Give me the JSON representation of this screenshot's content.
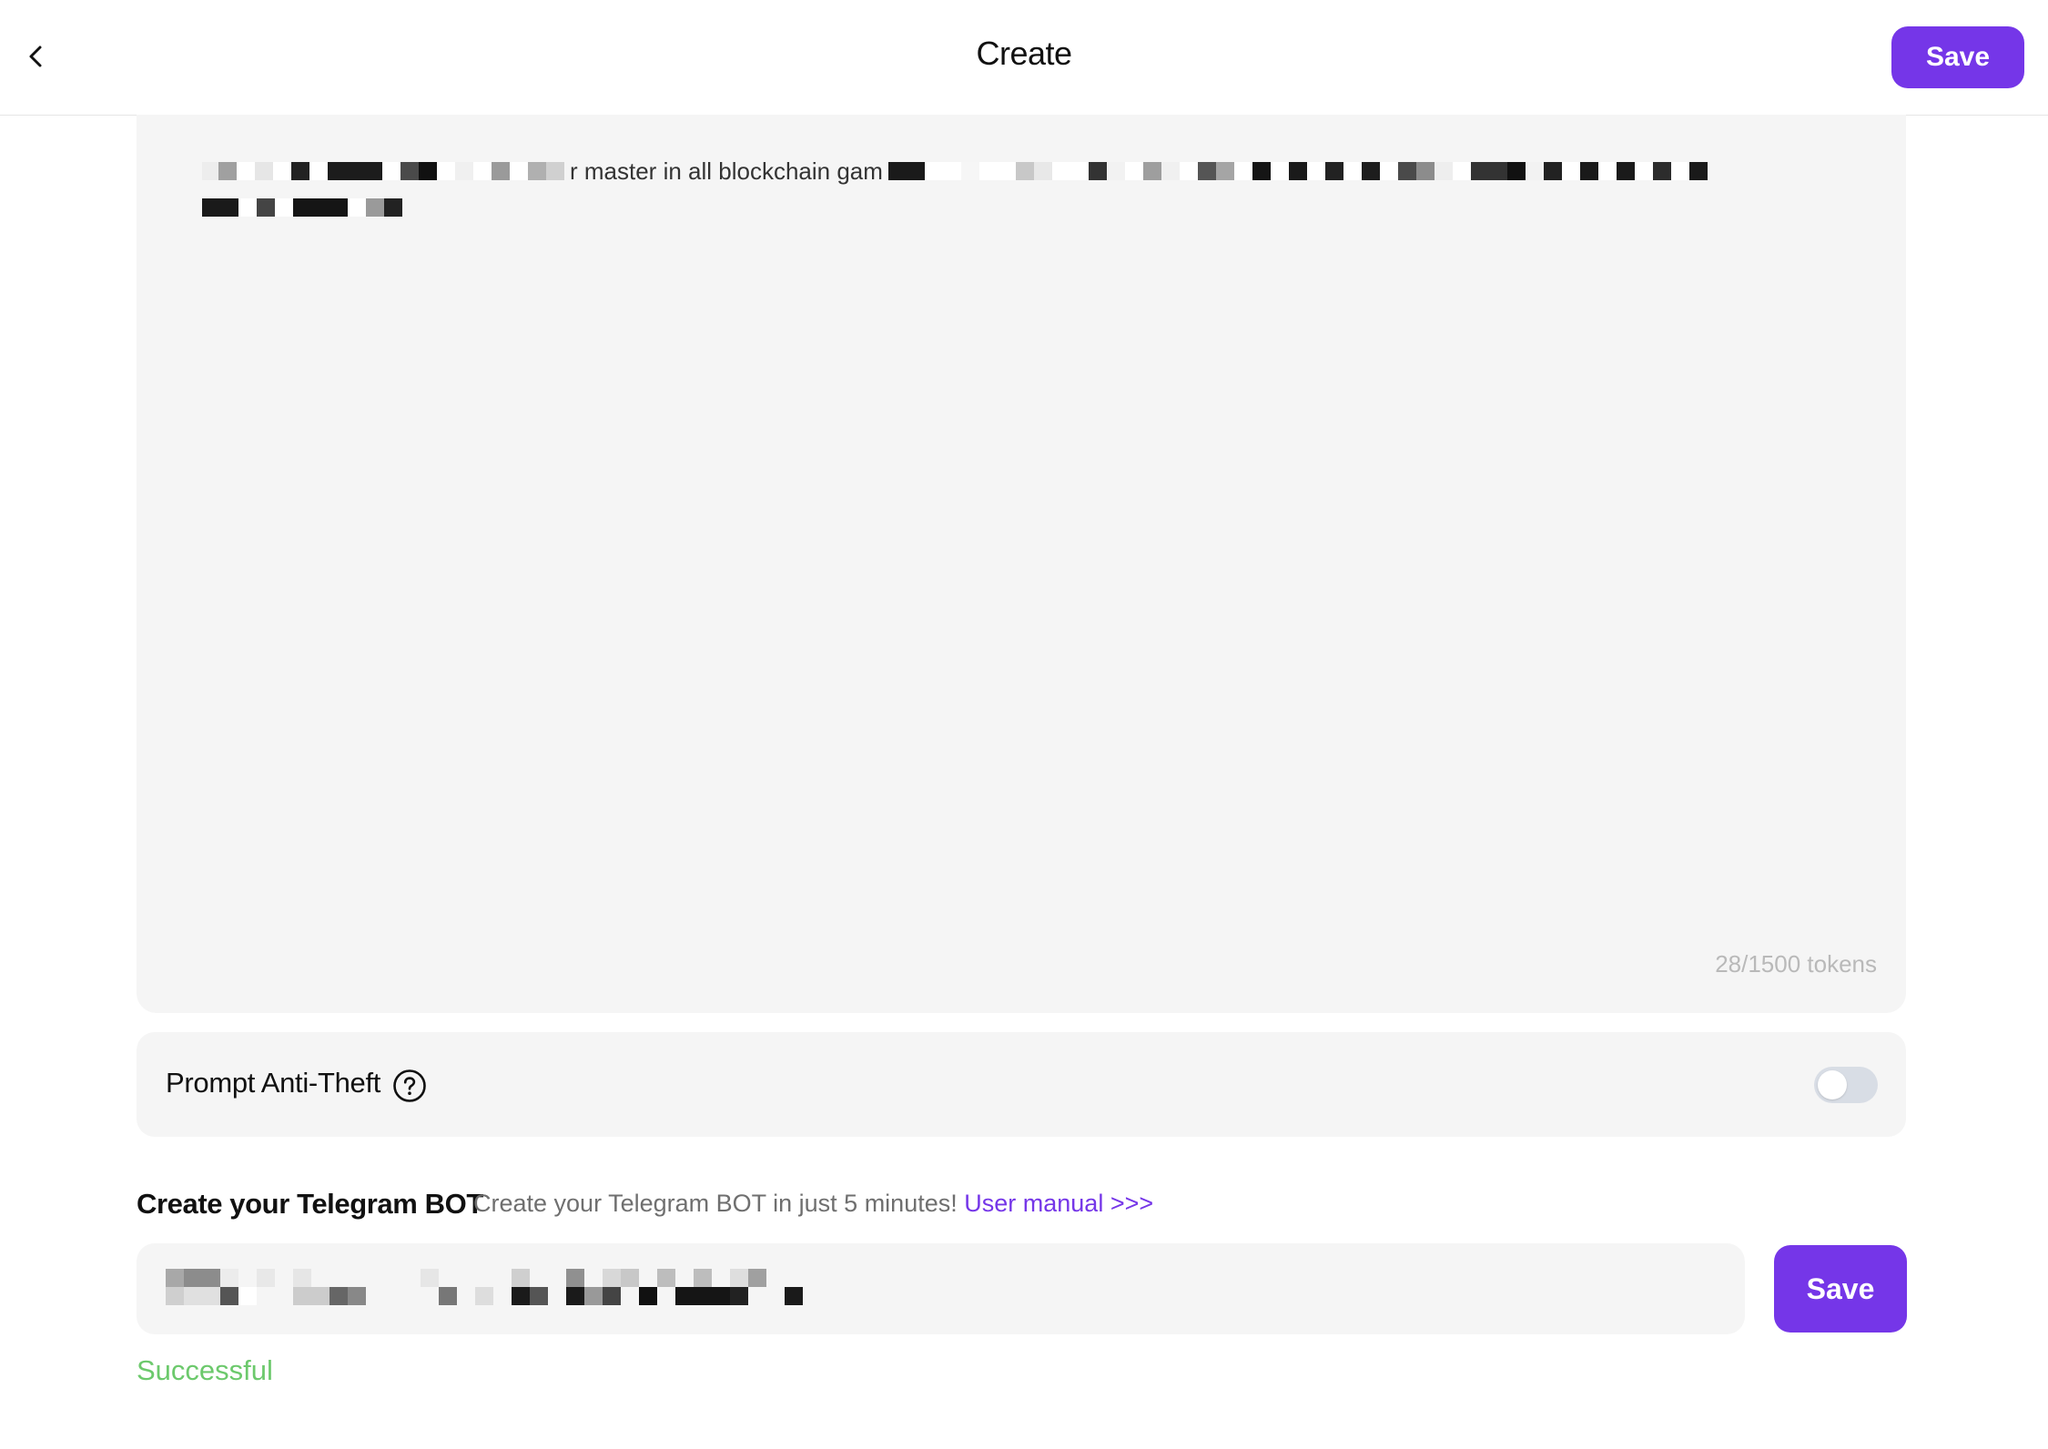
{
  "header": {
    "title": "Create",
    "save_label": "Save",
    "back_icon": "chevron-left-icon"
  },
  "prompt": {
    "visible_fragment": "r master in all blockchain gam",
    "token_count": "28/1500 tokens"
  },
  "anti_theft": {
    "label": "Prompt Anti-Theft",
    "help_icon": "question-circle-icon",
    "enabled": false
  },
  "telegram": {
    "title": "Create your Telegram BOT",
    "subtitle": "Create your Telegram BOT in just 5 minutes!",
    "manual_link": "User manual >>>",
    "save_label": "Save",
    "status": "Successful"
  },
  "colors": {
    "accent": "#7536e8",
    "success": "#6cc96c",
    "panel": "#f5f5f5"
  }
}
